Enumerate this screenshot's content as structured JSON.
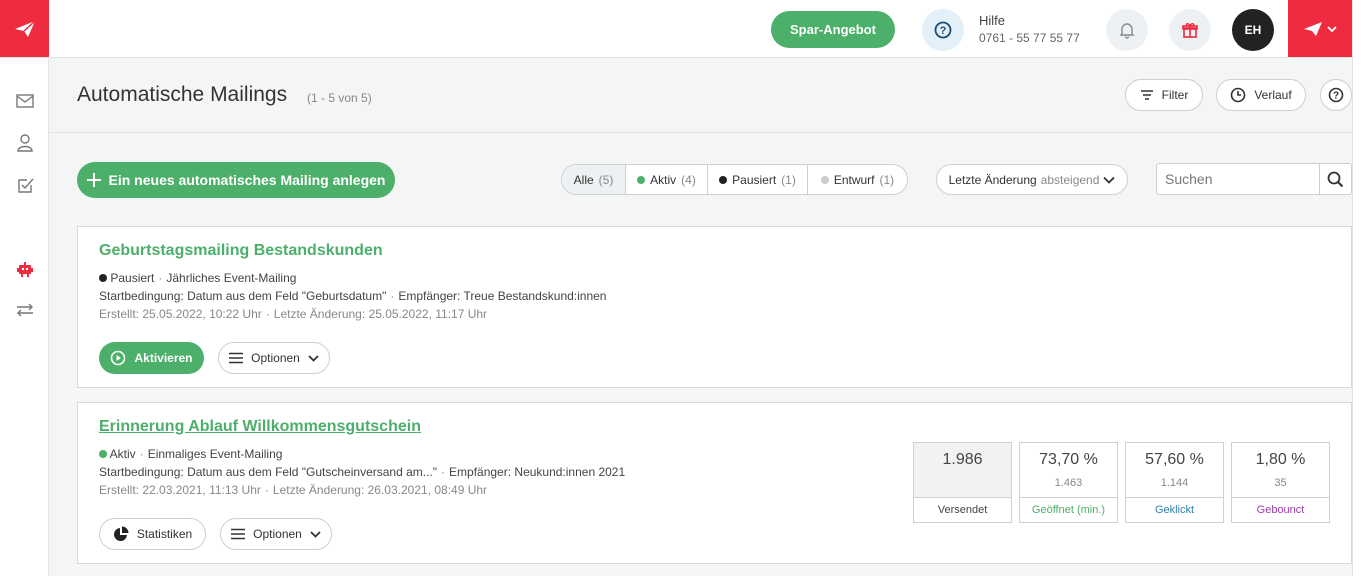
{
  "topbar": {
    "offer_label": "Spar-Angebot",
    "help_label": "Hilfe",
    "help_phone": "0761 - 55 77 55 77",
    "avatar_initials": "EH",
    "brand_color": "#ee2b3f",
    "accent_color": "#4caf6a"
  },
  "sidebar": {
    "items": [
      {
        "icon": "mail-icon"
      },
      {
        "icon": "user-icon"
      },
      {
        "icon": "checkbox-icon"
      },
      {
        "icon": "robot-icon",
        "active": true
      },
      {
        "icon": "transfer-icon"
      }
    ]
  },
  "header": {
    "title": "Automatische Mailings",
    "count": "(1 - 5 von 5)",
    "filter_label": "Filter",
    "history_label": "Verlauf"
  },
  "toolbar": {
    "new_label": "Ein neues automatisches Mailing anlegen",
    "tabs": [
      {
        "label": "Alle",
        "count": "(5)",
        "dot": ""
      },
      {
        "label": "Aktiv",
        "count": "(4)",
        "dot": "#4caf6a"
      },
      {
        "label": "Pausiert",
        "count": "(1)",
        "dot": "#222222"
      },
      {
        "label": "Entwurf",
        "count": "(1)",
        "dot": "#cccccc"
      }
    ],
    "sort_label": "Letzte Änderung",
    "sort_order": "absteigend",
    "search_placeholder": "Suchen"
  },
  "mailings": [
    {
      "title": "Geburtstagsmailing Bestandskunden",
      "status": "Pausiert",
      "type": "Jährliches Event-Mailing",
      "start": "Startbedingung: Datum aus dem Feld \"Geburtsdatum\"",
      "recipients": "Empfänger: Treue Bestandskund:innen",
      "created": "Erstellt: 25.05.2022, 10:22 Uhr",
      "changed": "Letzte Änderung: 25.05.2022, 11:17 Uhr",
      "primary_button": "Aktivieren",
      "options_button": "Optionen"
    },
    {
      "title": "Erinnerung Ablauf Willkommensgutschein",
      "status": "Aktiv",
      "type": "Einmaliges Event-Mailing",
      "start": "Startbedingung: Datum aus dem Feld \"Gutscheinversand am...\"",
      "recipients": "Empfänger: Neukund:innen 2021",
      "created": "Erstellt: 22.03.2021, 11:13 Uhr",
      "changed": "Letzte Änderung: 26.03.2021, 08:49 Uhr",
      "primary_button": "Statistiken",
      "options_button": "Optionen",
      "stats": [
        {
          "main": "1.986",
          "sub": "",
          "label": "Versendet",
          "color": "#444444"
        },
        {
          "main": "73,70 %",
          "sub": "1.463",
          "label": "Geöffnet (min.)",
          "color": "#4caf6a"
        },
        {
          "main": "57,60 %",
          "sub": "1.144",
          "label": "Geklickt",
          "color": "#2f7fa8"
        },
        {
          "main": "1,80 %",
          "sub": "35",
          "label": "Gebounct",
          "color": "#9b3fa8"
        }
      ]
    }
  ]
}
